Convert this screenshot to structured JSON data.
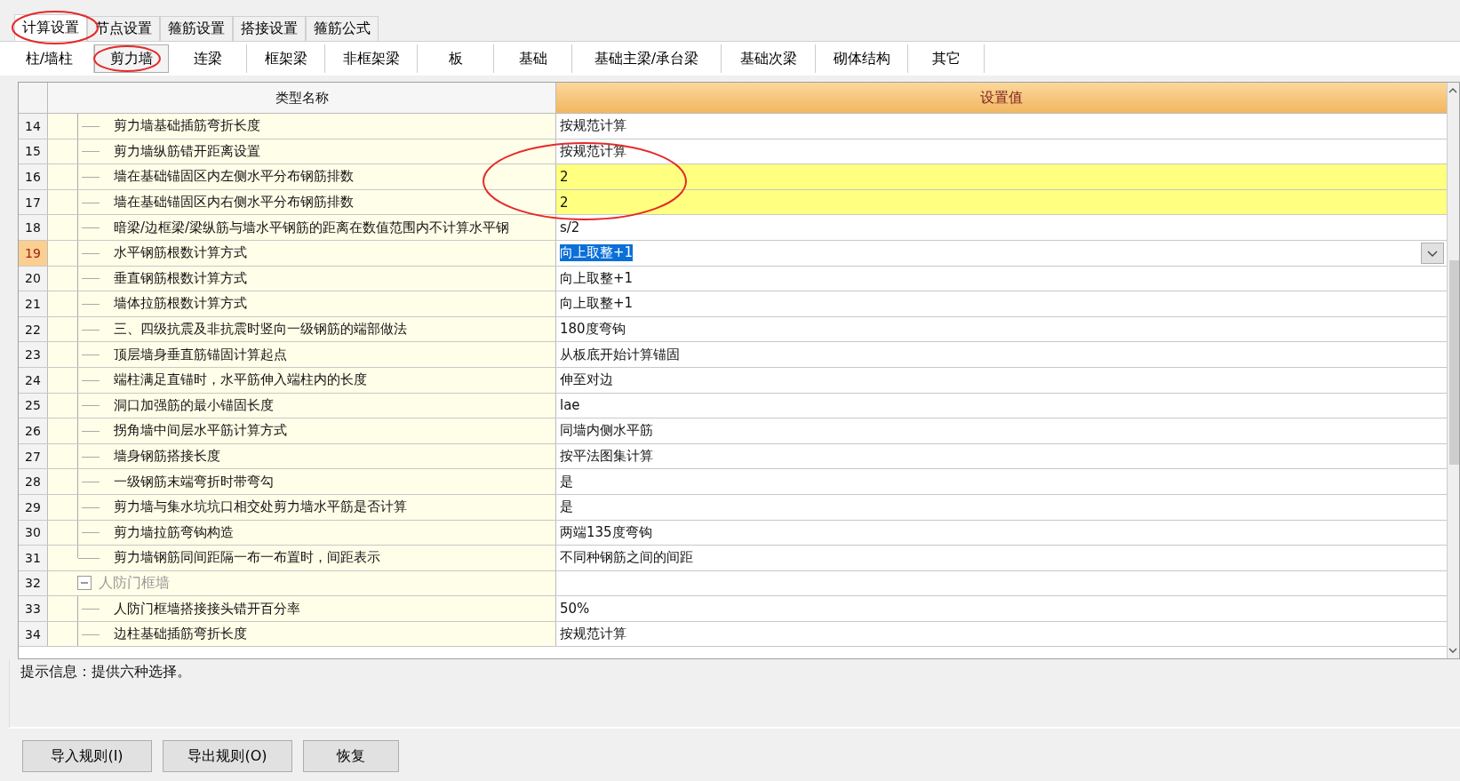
{
  "tabs": [
    {
      "label": "计算设置",
      "selected": true
    },
    {
      "label": "节点设置",
      "selected": false
    },
    {
      "label": "箍筋设置",
      "selected": false
    },
    {
      "label": "搭接设置",
      "selected": false
    },
    {
      "label": "箍筋公式",
      "selected": false
    }
  ],
  "subtabs": [
    {
      "label": "柱/墙柱",
      "selected": false
    },
    {
      "label": "剪力墙",
      "selected": true
    },
    {
      "label": "连梁",
      "selected": false
    },
    {
      "label": "框架梁",
      "selected": false
    },
    {
      "label": "非框架梁",
      "selected": false
    },
    {
      "label": "板",
      "selected": false
    },
    {
      "label": "基础",
      "selected": false
    },
    {
      "label": "基础主梁/承台梁",
      "selected": false
    },
    {
      "label": "基础次梁",
      "selected": false
    },
    {
      "label": "砌体结构",
      "selected": false
    },
    {
      "label": "其它",
      "selected": false
    }
  ],
  "table": {
    "columns": [
      "类型名称",
      "设置值"
    ],
    "rows": [
      {
        "kind": "item",
        "number": "14",
        "name": "剪力墙基础插筋弯折长度",
        "value": "按规范计算",
        "highlighted": false,
        "selected": false
      },
      {
        "kind": "item",
        "number": "15",
        "name": "剪力墙纵筋错开距离设置",
        "value": "按规范计算",
        "highlighted": false,
        "selected": false
      },
      {
        "kind": "item",
        "number": "16",
        "name": "墙在基础锚固区内左侧水平分布钢筋排数",
        "value": "2",
        "highlighted": true,
        "selected": false
      },
      {
        "kind": "item",
        "number": "17",
        "name": "墙在基础锚固区内右侧水平分布钢筋排数",
        "value": "2",
        "highlighted": true,
        "selected": false
      },
      {
        "kind": "item",
        "number": "18",
        "name": "暗梁/边框梁/梁纵筋与墙水平钢筋的距离在数值范围内不计算水平钢",
        "value": "s/2",
        "highlighted": false,
        "selected": false
      },
      {
        "kind": "item",
        "number": "19",
        "name": "水平钢筋根数计算方式",
        "value": "向上取整+1",
        "highlighted": false,
        "selected": true
      },
      {
        "kind": "item",
        "number": "20",
        "name": "垂直钢筋根数计算方式",
        "value": "向上取整+1",
        "highlighted": false,
        "selected": false
      },
      {
        "kind": "item",
        "number": "21",
        "name": "墙体拉筋根数计算方式",
        "value": "向上取整+1",
        "highlighted": false,
        "selected": false
      },
      {
        "kind": "item",
        "number": "22",
        "name": "三、四级抗震及非抗震时竖向一级钢筋的端部做法",
        "value": "180度弯钩",
        "highlighted": false,
        "selected": false
      },
      {
        "kind": "item",
        "number": "23",
        "name": "顶层墙身垂直筋锚固计算起点",
        "value": "从板底开始计算锚固",
        "highlighted": false,
        "selected": false
      },
      {
        "kind": "item",
        "number": "24",
        "name": "端柱满足直锚时，水平筋伸入端柱内的长度",
        "value": "伸至对边",
        "highlighted": false,
        "selected": false
      },
      {
        "kind": "item",
        "number": "25",
        "name": "洞口加强筋的最小锚固长度",
        "value": "lae",
        "highlighted": false,
        "selected": false
      },
      {
        "kind": "item",
        "number": "26",
        "name": "拐角墙中间层水平筋计算方式",
        "value": "同墙内侧水平筋",
        "highlighted": false,
        "selected": false
      },
      {
        "kind": "item",
        "number": "27",
        "name": "墙身钢筋搭接长度",
        "value": "按平法图集计算",
        "highlighted": false,
        "selected": false
      },
      {
        "kind": "item",
        "number": "28",
        "name": "一级钢筋末端弯折时带弯勾",
        "value": "是",
        "highlighted": false,
        "selected": false
      },
      {
        "kind": "item",
        "number": "29",
        "name": "剪力墙与集水坑坑口相交处剪力墙水平筋是否计算",
        "value": "是",
        "highlighted": false,
        "selected": false
      },
      {
        "kind": "item",
        "number": "30",
        "name": "剪力墙拉筋弯钩构造",
        "value": "两端135度弯钩",
        "highlighted": false,
        "selected": false
      },
      {
        "kind": "item",
        "number": "31",
        "name": "剪力墙钢筋同间距隔一布一布置时，间距表示",
        "value": "不同种钢筋之间的间距",
        "highlighted": false,
        "selected": false
      },
      {
        "kind": "group",
        "number": "32",
        "name": "人防门框墙",
        "expanded": true,
        "children": [
          {
            "kind": "item",
            "number": "33",
            "name": "人防门框墙搭接接头错开百分率",
            "value": "50%",
            "highlighted": false,
            "selected": false
          },
          {
            "kind": "item",
            "number": "34",
            "name": "边柱基础插筋弯折长度",
            "value": "按规范计算",
            "highlighted": false,
            "selected": false
          }
        ]
      }
    ]
  },
  "hint": "提示信息：提供六种选择。",
  "buttons": [
    "导入规则(I)",
    "导出规则(O)",
    "恢复"
  ]
}
